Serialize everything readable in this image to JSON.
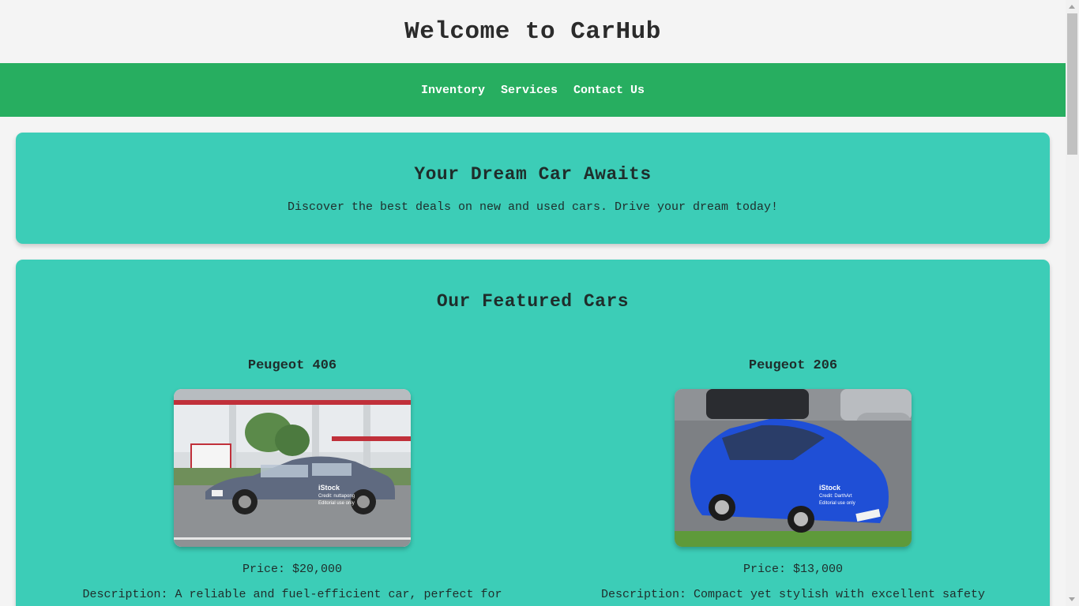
{
  "header": {
    "title": "Welcome to CarHub"
  },
  "nav": {
    "items": [
      "Inventory",
      "Services",
      "Contact Us"
    ]
  },
  "hero": {
    "title": "Your Dream Car Awaits",
    "text": "Discover the best deals on new and used cars. Drive your dream today!"
  },
  "featured": {
    "title": "Our Featured Cars",
    "cars": [
      {
        "name": "Peugeot 406",
        "price": "Price: $20,000",
        "description": "Description: A reliable and fuel-efficient car, perfect for",
        "image_watermark": {
          "brand": "iStock",
          "credit": "Credit: nuttapong",
          "note": "Editorial use only"
        },
        "color": "#5f6a80"
      },
      {
        "name": "Peugeot 206",
        "price": "Price: $13,000",
        "description": "Description: Compact yet stylish with excellent safety",
        "image_watermark": {
          "brand": "iStock",
          "credit": "Credit: DarthArt",
          "note": "Editorial use only"
        },
        "color": "#1f4fd6"
      }
    ]
  },
  "colors": {
    "nav": "#27ae60",
    "panel": "#3ccdb7",
    "background": "#f4f4f4"
  }
}
